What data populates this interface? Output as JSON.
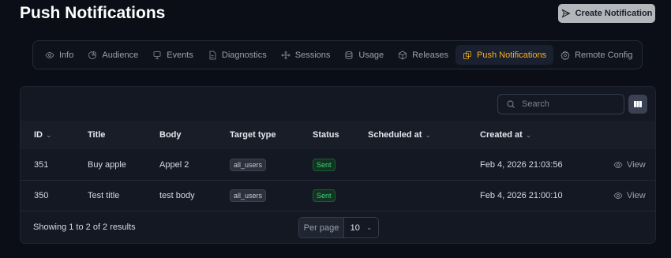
{
  "header": {
    "title": "Push Notifications",
    "create_label": "Create Notification"
  },
  "tabs": [
    {
      "label": "Info",
      "icon": "eye-icon"
    },
    {
      "label": "Audience",
      "icon": "pie-chart-icon"
    },
    {
      "label": "Events",
      "icon": "monitor-icon"
    },
    {
      "label": "Diagnostics",
      "icon": "document-icon"
    },
    {
      "label": "Sessions",
      "icon": "network-icon"
    },
    {
      "label": "Usage",
      "icon": "database-icon"
    },
    {
      "label": "Releases",
      "icon": "package-icon"
    },
    {
      "label": "Push Notifications",
      "icon": "push-icon",
      "active": true
    },
    {
      "label": "Remote Config",
      "icon": "gear-icon"
    }
  ],
  "colors": {
    "accent": "#f2b418",
    "background": "#0b0e17",
    "panel": "#131823",
    "status_green": "#3fd37a"
  },
  "toolbar": {
    "search_placeholder": "Search"
  },
  "table": {
    "headers": {
      "id": "ID",
      "title": "Title",
      "body": "Body",
      "target_type": "Target type",
      "status": "Status",
      "scheduled_at": "Scheduled at",
      "created_at": "Created at"
    },
    "rows": [
      {
        "id": "351",
        "title": "Buy apple",
        "body": "Appel 2",
        "target_type": "all_users",
        "status": "Sent",
        "scheduled_at": "",
        "created_at": "Feb 4, 2026 21:03:56",
        "action": "View"
      },
      {
        "id": "350",
        "title": "Test title",
        "body": "test body",
        "target_type": "all_users",
        "status": "Sent",
        "scheduled_at": "",
        "created_at": "Feb 4, 2026 21:00:10",
        "action": "View"
      }
    ]
  },
  "footer": {
    "summary": "Showing 1 to 2 of 2 results",
    "per_page_label": "Per page",
    "per_page_value": "10"
  }
}
